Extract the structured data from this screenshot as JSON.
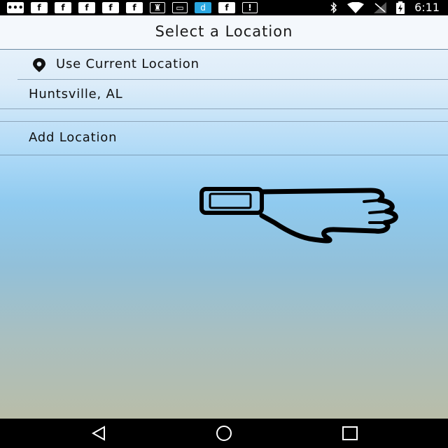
{
  "status_bar": {
    "time": "6:11",
    "notification_icons": [
      "message-icon",
      "facebook-icon",
      "facebook-icon",
      "facebook-icon",
      "facebook-icon",
      "facebook-icon",
      "keyhole-icon",
      "mail-icon",
      "d-app-icon",
      "facebook-icon",
      "alert-icon"
    ],
    "glyphs": {
      "facebook": "f",
      "d_app": "d",
      "alert": "!",
      "message": "•••",
      "keyhole": "♜",
      "mail": "▭"
    }
  },
  "header": {
    "title": "Select a Location"
  },
  "locations": {
    "use_current": "Use Current Location",
    "saved": [
      "Huntsville, AL"
    ],
    "add": "Add Location"
  },
  "illustration": {
    "icon": "thumbs-down-icon"
  },
  "nav_bar": {
    "buttons": [
      "back-icon",
      "home-icon",
      "recent-apps-icon"
    ]
  },
  "colors": {
    "status_bar": "#000000",
    "nav_bar": "#000000",
    "d_app_accent": "#29a7e1",
    "divider": "#8ea6ba"
  }
}
